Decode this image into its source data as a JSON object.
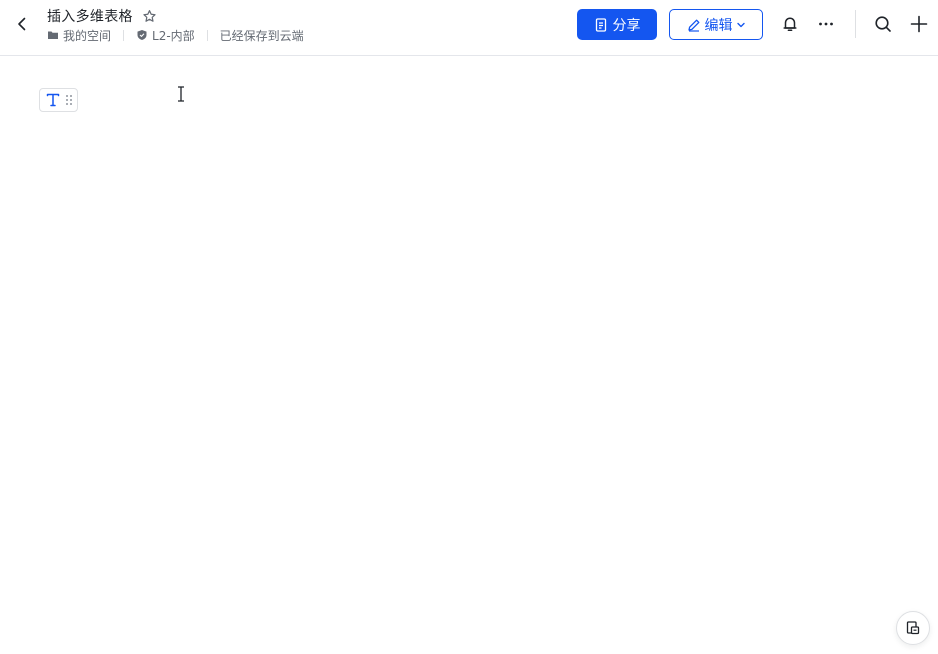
{
  "header": {
    "title": "插入多维表格",
    "breadcrumb": {
      "space": "我的空间",
      "security_level": "L2-内部",
      "save_status": "已经保存到云端"
    },
    "share_label": "分享",
    "edit_label": "编辑"
  },
  "icons": {
    "back": "chevron-left-icon",
    "favorite": "star-icon",
    "folder": "folder-icon",
    "shield": "shield-icon",
    "share": "share-doc-icon",
    "edit": "pencil-icon",
    "notification": "bell-icon",
    "more": "more-icon",
    "search": "search-icon",
    "add": "plus-icon",
    "text_block": "text-type-icon",
    "drag": "drag-handle-icon",
    "float": "doc-outline-icon"
  },
  "colors": {
    "accent": "#1456f0",
    "text_primary": "#1f2329",
    "text_secondary": "#646a73",
    "border": "#e4e6eb"
  }
}
